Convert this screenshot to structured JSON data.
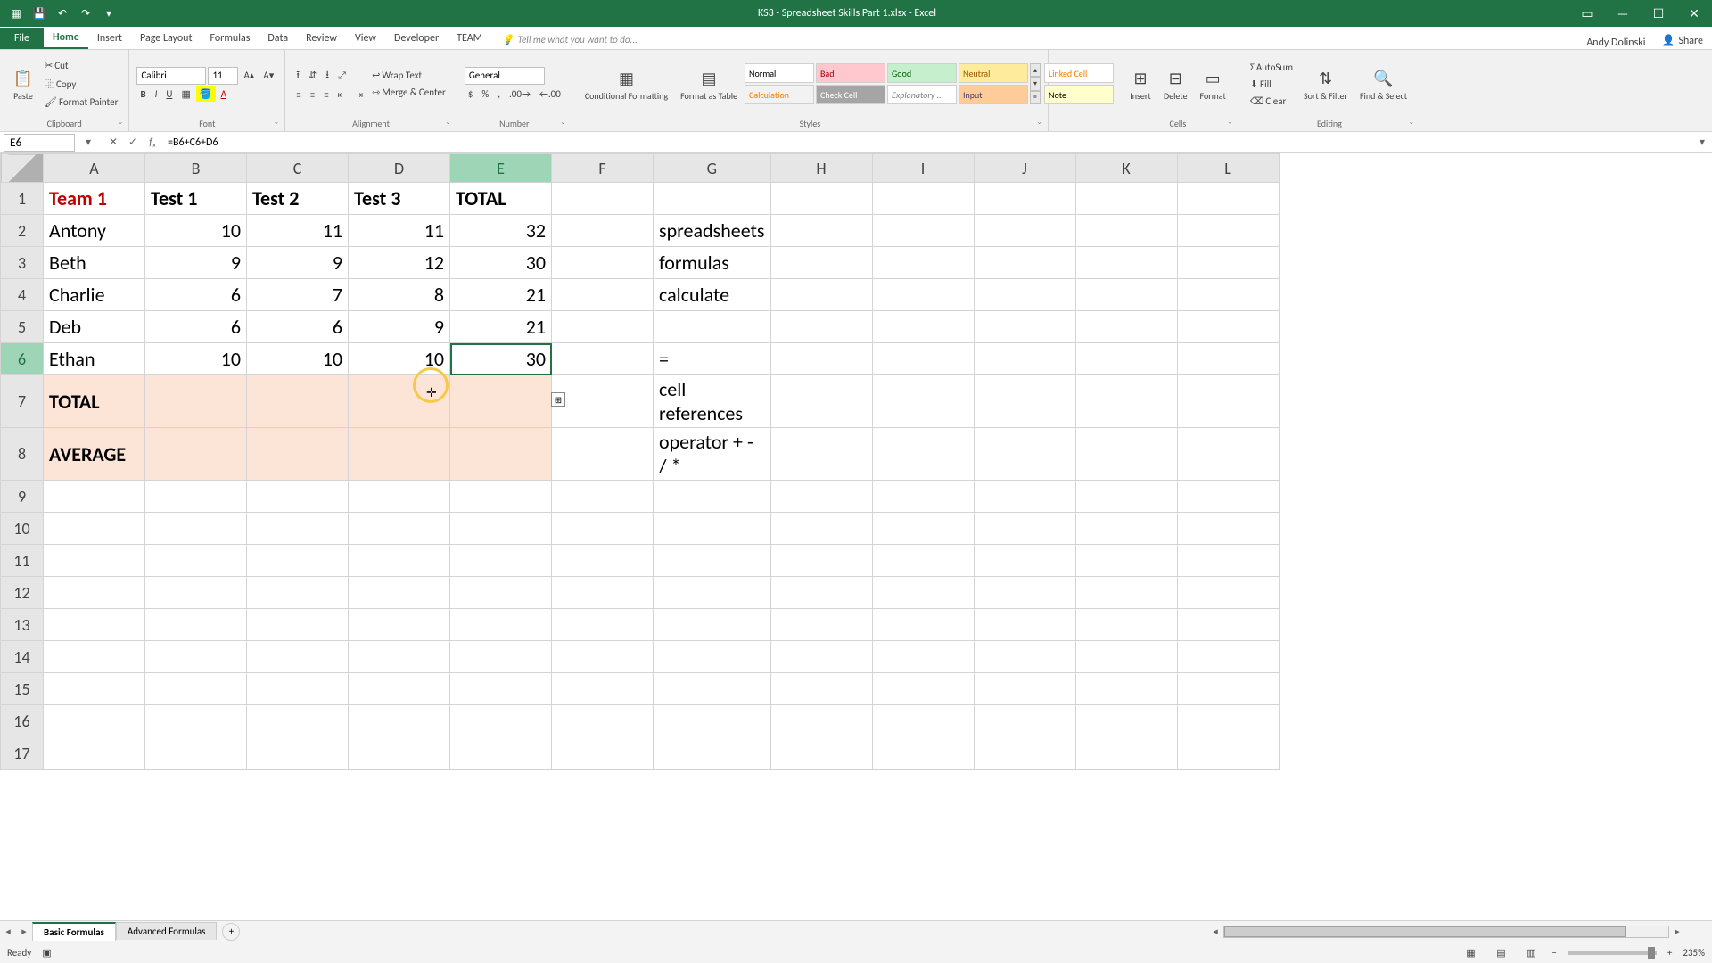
{
  "title": "KS3 - Spreadsheet Skills Part 1.xlsx - Excel",
  "user": "Andy Dolinski",
  "share": "Share",
  "tabs": {
    "file": "File",
    "home": "Home",
    "insert": "Insert",
    "pagelayout": "Page Layout",
    "formulas": "Formulas",
    "data": "Data",
    "review": "Review",
    "view": "View",
    "developer": "Developer",
    "team": "TEAM",
    "tellme": "Tell me what you want to do..."
  },
  "ribbon": {
    "clipboard": {
      "paste": "Paste",
      "cut": "Cut",
      "copy": "Copy",
      "painter": "Format Painter",
      "label": "Clipboard"
    },
    "font": {
      "name": "Calibri",
      "size": "11",
      "label": "Font"
    },
    "alignment": {
      "wrap": "Wrap Text",
      "merge": "Merge & Center",
      "label": "Alignment"
    },
    "number": {
      "format": "General",
      "label": "Number"
    },
    "styles": {
      "cond": "Conditional Formatting",
      "table": "Format as Table",
      "s1": "Normal",
      "s2": "Bad",
      "s3": "Good",
      "s4": "Neutral",
      "s5": "Calculation",
      "s6": "Check Cell",
      "s7": "Explanatory ...",
      "s8": "Input",
      "s9": "Linked Cell",
      "s10": "Note",
      "label": "Styles"
    },
    "cells": {
      "insert": "Insert",
      "delete": "Delete",
      "format": "Format",
      "label": "Cells"
    },
    "editing": {
      "sum": "AutoSum",
      "fill": "Fill",
      "clear": "Clear",
      "sort": "Sort & Filter",
      "find": "Find & Select",
      "label": "Editing"
    }
  },
  "namebox": "E6",
  "formula": "=B6+C6+D6",
  "columns": [
    "A",
    "B",
    "C",
    "D",
    "E",
    "F",
    "G",
    "H",
    "I",
    "J",
    "K",
    "L"
  ],
  "col_widths": [
    "wA",
    "wB",
    "wC",
    "wD",
    "wE",
    "wF",
    "wG",
    "wH",
    "wI",
    "wJ",
    "wK",
    "wL"
  ],
  "selected_col": "E",
  "selected_row": 6,
  "rows": [
    1,
    2,
    3,
    4,
    5,
    6,
    7,
    8,
    9,
    10,
    11,
    12,
    13,
    14,
    15,
    16,
    17
  ],
  "grid": {
    "A1": "Team 1",
    "B1": "Test 1",
    "C1": "Test 2",
    "D1": "Test 3",
    "E1": "TOTAL",
    "A2": "Antony",
    "B2": "10",
    "C2": "11",
    "D2": "11",
    "E2": "32",
    "G2": "spreadsheets",
    "A3": "Beth",
    "B3": "9",
    "C3": "9",
    "D3": "12",
    "E3": "30",
    "G3": "formulas",
    "A4": "Charlie",
    "B4": "6",
    "C4": "7",
    "D4": "8",
    "E4": "21",
    "G4": "calculate",
    "A5": "Deb",
    "B5": "6",
    "C5": "6",
    "D5": "9",
    "E5": "21",
    "A6": "Ethan",
    "B6": "10",
    "C6": "10",
    "D6": "10",
    "E6": "30",
    "G6": "=",
    "A7": "TOTAL",
    "G7": "cell references",
    "A8": "AVERAGE",
    "G8": "operator +  -  /  *"
  },
  "cell_classes": {
    "A1": "red",
    "B1": "bold",
    "C1": "bold",
    "D1": "bold",
    "E1": "bold",
    "B2": "num",
    "C2": "num",
    "D2": "num",
    "E2": "num",
    "B3": "num",
    "C3": "num",
    "D3": "num",
    "E3": "num",
    "B4": "num",
    "C4": "num",
    "D4": "num",
    "E4": "num",
    "B5": "num",
    "C5": "num",
    "D5": "num",
    "E5": "num",
    "B6": "num",
    "C6": "num",
    "D6": "num",
    "E6": "num selected",
    "A7": "bold peach",
    "B7": "peach",
    "C7": "peach",
    "D7": "peach",
    "E7": "peach",
    "A8": "bold peach",
    "B8": "peach",
    "C8": "peach",
    "D8": "peach",
    "E8": "peach"
  },
  "sheets": {
    "s1": "Basic Formulas",
    "s2": "Advanced Formulas"
  },
  "status": {
    "ready": "Ready",
    "zoom": "235%"
  }
}
